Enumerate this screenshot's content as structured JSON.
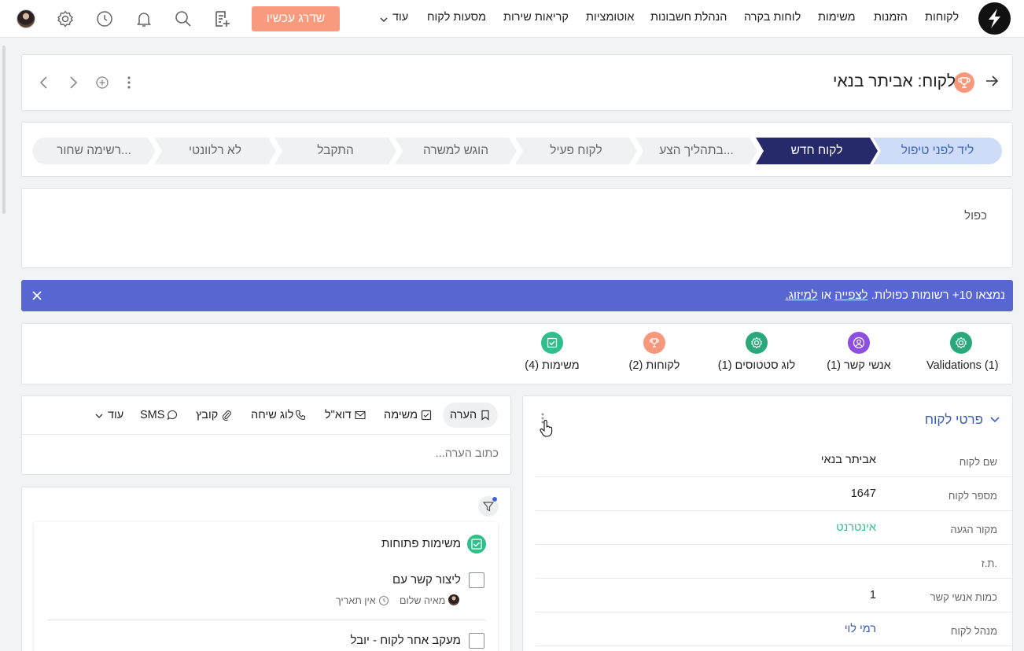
{
  "nav": {
    "items": [
      "לקוחות",
      "הזמנות",
      "משימות",
      "לוחות בקרה",
      "הנהלת חשבונות",
      "אוטומציות",
      "קריאות שירות",
      "מסעות לקוח",
      "עוד"
    ],
    "upgrade_label": "שדרג עכשיו",
    "brand_color": "#f79a7e"
  },
  "record": {
    "title": "לקוח: אביתר בנאי"
  },
  "stages": [
    "ליד לפני טיפול",
    "לקוח חדש",
    "בתהליך הצע...",
    "לקוח פעיל",
    "הוגש למשרה",
    "התקבל",
    "לא רלוונטי",
    "רשימה שחור..."
  ],
  "duplicate_box": {
    "label": "כפול"
  },
  "banner": {
    "text_before": "נמצאו 10+ רשומות כפולות. ",
    "link_view": "לצפייה",
    "text_or": " או ",
    "link_merge": "למיזוג.",
    "color": "#5766d1"
  },
  "related": [
    {
      "label": "Validations (1)",
      "icon": "gear-icon",
      "color": "#29a97a"
    },
    {
      "label": "אנשי קשר (1)",
      "icon": "user-icon",
      "color": "#8e4fe0"
    },
    {
      "label": "לוג סטטוסים (1)",
      "icon": "gear-icon",
      "color": "#29a97a"
    },
    {
      "label": "לקוחות (2)",
      "icon": "trophy-icon",
      "color": "#f7977c"
    },
    {
      "label": "משימות (4)",
      "icon": "check-icon",
      "color": "#2fbf8a"
    }
  ],
  "activity": {
    "tabs": [
      "הערה",
      "משימה",
      "דוא\"ל",
      "לוג שיחה",
      "קובץ",
      "SMS",
      "עוד"
    ],
    "note_placeholder": "כתוב הערה..."
  },
  "tasks": {
    "section_title": "משימות פתוחות",
    "items": [
      {
        "title": "ליצור קשר עם",
        "owner": "מאיה שלום",
        "due": "אין תאריך"
      },
      {
        "title": "מעקב אחר לקוח - יובל"
      }
    ]
  },
  "details": {
    "section_title": "פרטי לקוח",
    "fields": [
      {
        "label": "שם לקוח",
        "value": "אביתר בנאי",
        "color": "#222222"
      },
      {
        "label": "מספר לקוח",
        "value": "1647",
        "color": "#222222"
      },
      {
        "label": "מקור הגעה",
        "value": "אינטרנט",
        "color": "#2fbf8a"
      },
      {
        "label": "ת.ז.",
        "value": "",
        "color": "#222222"
      },
      {
        "label": "כמות אנשי קשר",
        "value": "1",
        "color": "#222222"
      },
      {
        "label": "מנהל לקוח",
        "value": "רמי לוי",
        "color": "#3b5bb5"
      }
    ]
  }
}
